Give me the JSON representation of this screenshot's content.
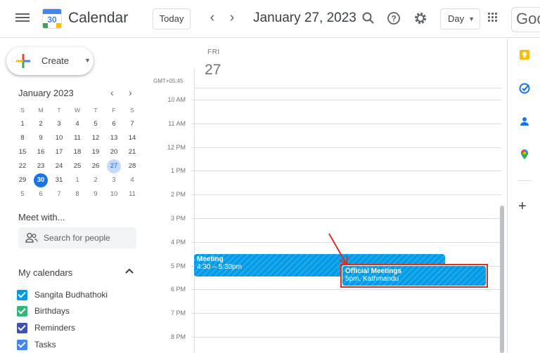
{
  "header": {
    "app_name": "Calendar",
    "logo_day": "30",
    "today_label": "Today",
    "date_title": "January 27, 2023",
    "view_label": "Day",
    "google_partial": "Goo"
  },
  "sidebar": {
    "create_label": "Create",
    "mini_calendar": {
      "title": "January 2023",
      "weekdays": [
        "S",
        "M",
        "T",
        "W",
        "T",
        "F",
        "S"
      ],
      "weeks": [
        [
          "1",
          "2",
          "3",
          "4",
          "5",
          "6",
          "7"
        ],
        [
          "8",
          "9",
          "10",
          "11",
          "12",
          "13",
          "14"
        ],
        [
          "15",
          "16",
          "17",
          "18",
          "19",
          "20",
          "21"
        ],
        [
          "22",
          "23",
          "24",
          "25",
          "26",
          "27",
          "28"
        ],
        [
          "29",
          "30",
          "31",
          "1",
          "2",
          "3",
          "4"
        ],
        [
          "5",
          "6",
          "7",
          "8",
          "9",
          "10",
          "11"
        ]
      ],
      "selected_day": "27",
      "today_day": "30"
    },
    "meet_with_label": "Meet with...",
    "search_placeholder": "Search for people",
    "my_calendars_label": "My calendars",
    "calendars": [
      {
        "name": "Sangita Budhathoki",
        "color": "#039be5"
      },
      {
        "name": "Birthdays",
        "color": "#33b679"
      },
      {
        "name": "Reminders",
        "color": "#3f51b5"
      },
      {
        "name": "Tasks",
        "color": "#4285f4"
      }
    ]
  },
  "day_view": {
    "day_of_week": "FRI",
    "day_number": "27",
    "timezone": "GMT+05:45",
    "hours": [
      "10 AM",
      "11 AM",
      "12 PM",
      "1 PM",
      "2 PM",
      "3 PM",
      "4 PM",
      "5 PM",
      "6 PM",
      "7 PM",
      "8 PM"
    ],
    "events": [
      {
        "title": "Meeting",
        "time": "4:30 – 5:30pm",
        "color": "#039be5"
      },
      {
        "title": "Official Meetings",
        "time": "5pm, Kathmandu",
        "color": "#039be5"
      }
    ]
  },
  "right_rail": {
    "icons": [
      "keep-icon",
      "tasks-icon",
      "contacts-icon",
      "maps-icon",
      "add-icon"
    ]
  },
  "colors": {
    "accent": "#1a73e8",
    "event": "#039be5",
    "annotation": "#d93025"
  }
}
